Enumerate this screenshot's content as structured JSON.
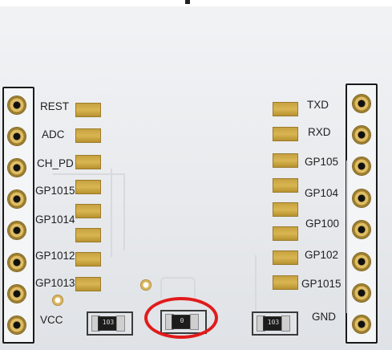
{
  "left_pins": [
    "REST",
    "ADC",
    "CH_PD",
    "GP1015",
    "GP1014",
    "GP1012",
    "GP1013",
    "VCC"
  ],
  "right_pins": [
    "TXD",
    "RXD",
    "GP105",
    "GP104",
    "GP100",
    "GP102",
    "GP1015",
    "GND"
  ],
  "resistors": {
    "left_code": "103",
    "middle_code": "0",
    "right_code": "103"
  },
  "highlight": {
    "color": "#e11b1b",
    "target": "middle-resistor"
  },
  "colors": {
    "board": "#e9ebee",
    "pad_gold": "#d9b652",
    "silkscreen": "#1f1f1f"
  }
}
